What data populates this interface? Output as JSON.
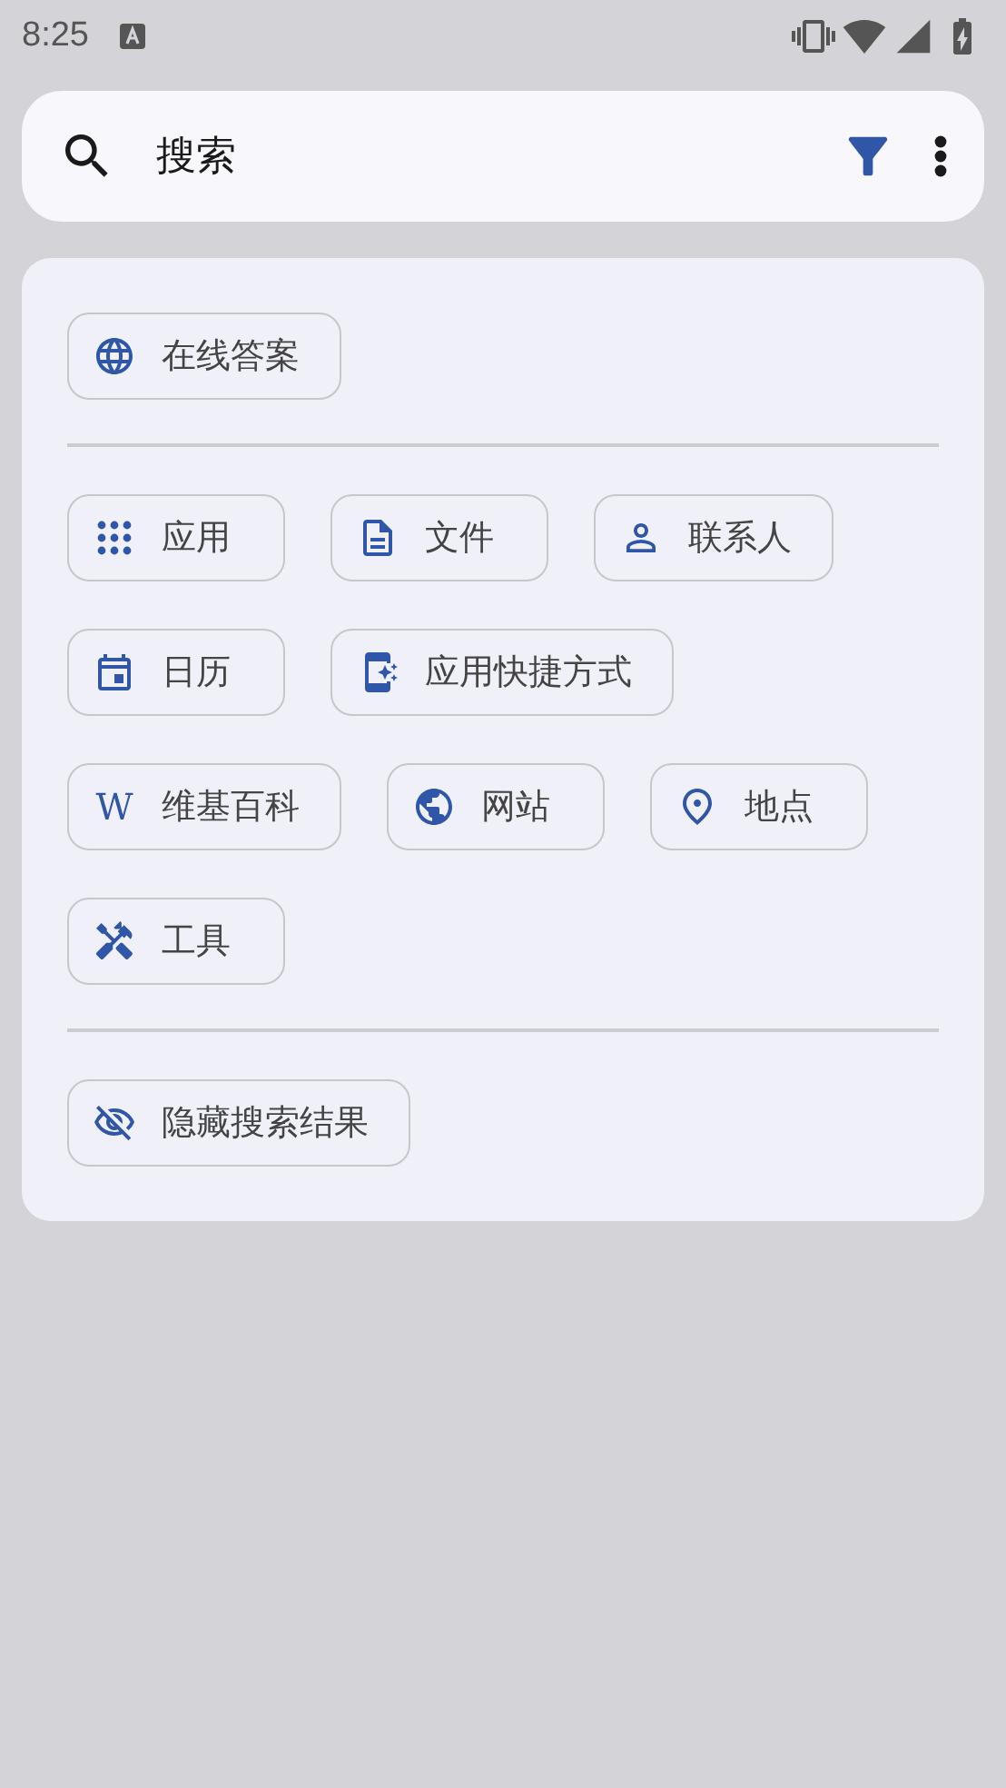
{
  "status_bar": {
    "time": "8:25"
  },
  "search": {
    "placeholder": "搜索"
  },
  "groups": [
    {
      "chips": [
        {
          "kind": "globe",
          "label": "在线答案"
        }
      ]
    },
    {
      "chips": [
        {
          "kind": "apps",
          "label": "应用"
        },
        {
          "kind": "file",
          "label": "文件"
        },
        {
          "kind": "person",
          "label": "联系人"
        },
        {
          "kind": "calendar",
          "label": "日历"
        },
        {
          "kind": "shortcut",
          "label": "应用快捷方式"
        },
        {
          "kind": "letter",
          "icon_text": "W",
          "label": "维基百科"
        },
        {
          "kind": "public",
          "label": "网站"
        },
        {
          "kind": "place",
          "label": "地点"
        },
        {
          "kind": "tools",
          "label": "工具"
        }
      ]
    },
    {
      "chips": [
        {
          "kind": "hidden",
          "label": "隐藏搜索结果"
        }
      ]
    }
  ]
}
